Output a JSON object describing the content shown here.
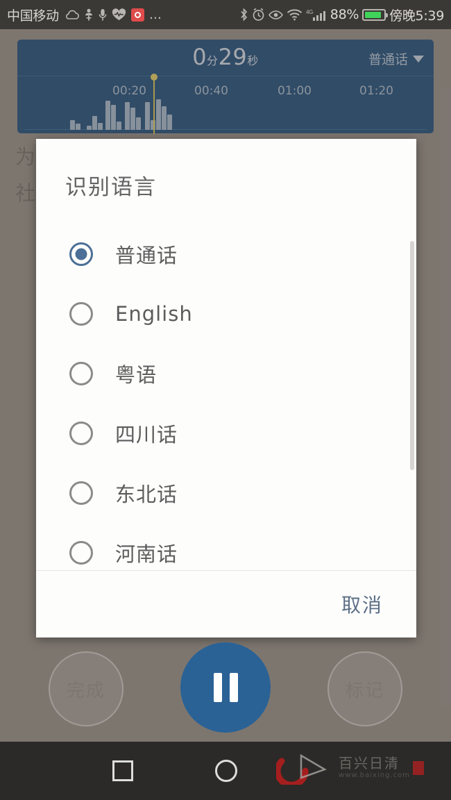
{
  "status_bar": {
    "carrier": "中国移动",
    "left_icons": [
      "cloud-icon",
      "person-icon",
      "mic-icon",
      "heart-icon",
      "app-badge-icon",
      "overflow-dots-icon"
    ],
    "overflow": "…",
    "right_icons": [
      "bluetooth-icon",
      "alarm-icon",
      "eye-care-icon",
      "wifi-icon",
      "signal-bars-icon"
    ],
    "network_type": "4G",
    "battery_percent": "88%",
    "battery_fill_pct": 88,
    "clock": "傍晚5:39"
  },
  "recorder": {
    "timer_minutes": "0",
    "timer_minutes_unit": "分",
    "timer_seconds": "29",
    "timer_seconds_unit": "秒",
    "timer_full": "0分29秒",
    "language_label": "普通话",
    "caret_icon": "chevron-down-icon",
    "timeline_ticks": [
      "00:20",
      "00:40",
      "01:00",
      "01:20"
    ],
    "playhead_position": "00:29",
    "panel_color": "#2d5680",
    "playhead_color": "#d9c45e"
  },
  "background_article": {
    "line1": "为                                                                市",
    "line2": "社"
  },
  "dialog": {
    "title": "识别语言",
    "selected_index": 0,
    "options": [
      {
        "label": "普通话",
        "selected": true
      },
      {
        "label": "English",
        "selected": false
      },
      {
        "label": "粤语",
        "selected": false
      },
      {
        "label": "四川话",
        "selected": false
      },
      {
        "label": "东北话",
        "selected": false
      },
      {
        "label": "河南话",
        "selected": false
      }
    ],
    "cancel_label": "取消",
    "accent_color": "#4b6f96",
    "cancel_color": "#5c6f86"
  },
  "transport": {
    "done_label": "完成",
    "mark_label": "标记",
    "pause_icon": "pause-icon",
    "pause_color": "#2a6296"
  },
  "nav_bar": {
    "recents_icon": "square-recents-icon",
    "home_icon": "circle-home-icon",
    "watermark_main": "百兴日清",
    "watermark_sub": "www.baixing.com",
    "watermark_icon": "swoosh-logo-icon"
  }
}
